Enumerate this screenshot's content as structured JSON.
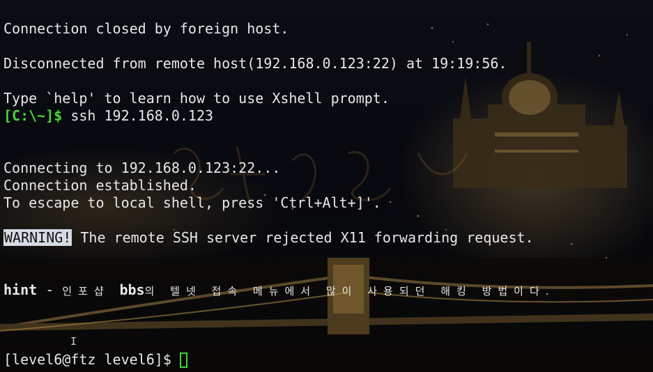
{
  "terminal": {
    "lines": {
      "l1": "Connection closed by foreign host.",
      "l2": "Disconnected from remote host(192.168.0.123:22) at 19:19:56.",
      "l3": "Type `help' to learn how to use Xshell prompt.",
      "l4_prompt": "[C:\\~]$",
      "l4_cmd": " ssh 192.168.0.123",
      "l5": "Connecting to 192.168.0.123:22...",
      "l6": "Connection established.",
      "l7": "To escape to local shell, press 'Ctrl+Alt+]'.",
      "l8_badge": "WARNING!",
      "l8_text": " The remote SSH server rejected X11 forwarding request.",
      "l9_hint": "hint",
      "l9_dash": " - ",
      "l9_kr1": "인포샵 ",
      "l9_bbs": "bbs",
      "l9_kr2": "의 텔넷 접속 메뉴에서 많이 사용되던 해킹 방법이다.",
      "l10_prompt": "[level6@ftz level6]$ "
    },
    "mouse_cursor_glyph": "I",
    "colors": {
      "text": "#e8e8e8",
      "prompt_green": "#4cd63c",
      "warning_bg": "#d4dbe3",
      "cursor": "#3fd43a"
    }
  }
}
